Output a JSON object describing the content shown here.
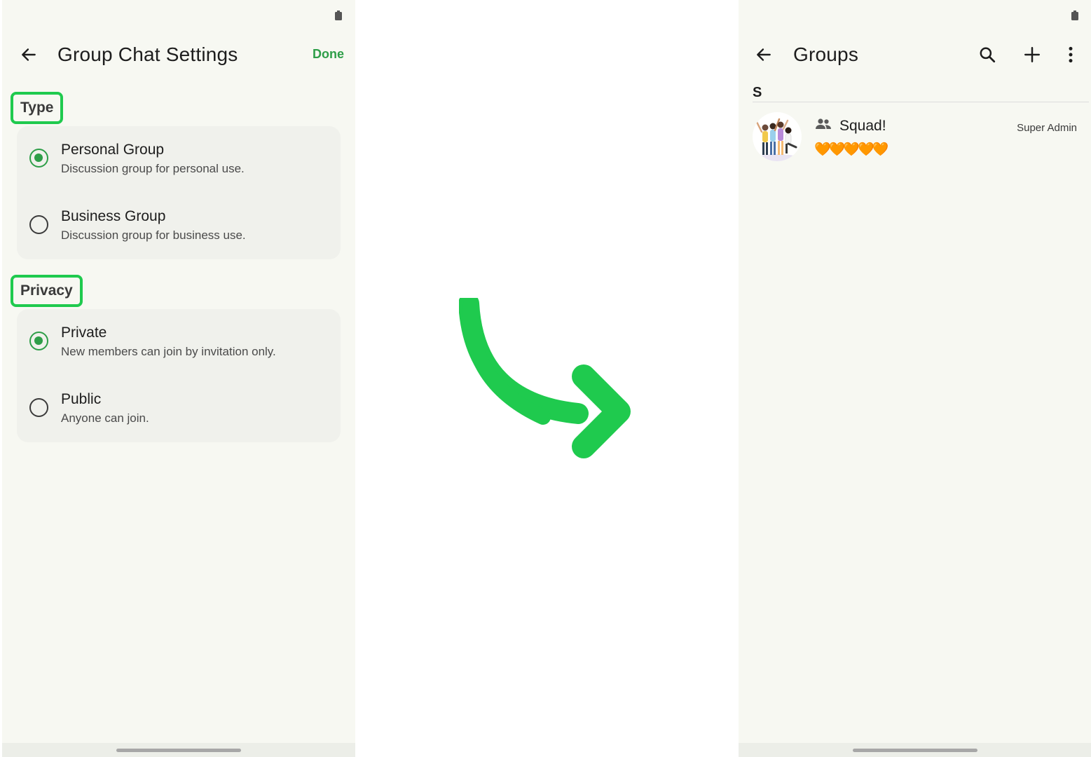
{
  "colors": {
    "accent": "#2e9e48",
    "highlight": "#1fca4e",
    "screen_bg": "#f7f8f2",
    "card_bg": "#f0f1ec"
  },
  "left_screen": {
    "title": "Group Chat Settings",
    "done_label": "Done",
    "type_section": {
      "label": "Type",
      "options": [
        {
          "title": "Personal Group",
          "subtitle": "Discussion group for personal use.",
          "selected": true
        },
        {
          "title": "Business Group",
          "subtitle": "Discussion group for business use.",
          "selected": false
        }
      ]
    },
    "privacy_section": {
      "label": "Privacy",
      "options": [
        {
          "title": "Private",
          "subtitle": "New members can join by invitation only.",
          "selected": true
        },
        {
          "title": "Public",
          "subtitle": "Anyone can join.",
          "selected": false
        }
      ]
    }
  },
  "right_screen": {
    "title": "Groups",
    "section_header": "S",
    "groups": [
      {
        "name": "Squad!",
        "role": "Super Admin",
        "description": "🧡🧡🧡🧡🧡"
      }
    ]
  },
  "icons": {
    "back": "arrow-left-icon",
    "search": "search-icon",
    "add": "plus-icon",
    "more": "more-vert-icon",
    "group": "people-icon",
    "battery": "battery-icon",
    "transition": "curved-arrow-icon"
  }
}
